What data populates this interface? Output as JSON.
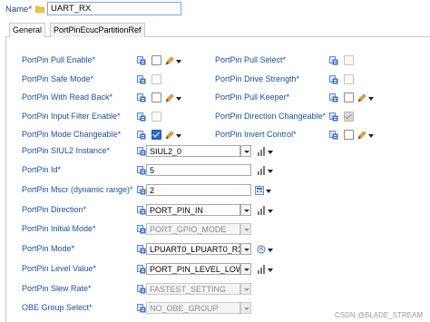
{
  "name": {
    "label": "Name",
    "required_mark": "*",
    "value": "UART_RX"
  },
  "tabs": [
    {
      "label": "General",
      "active": true
    },
    {
      "label": "PortPinEcucPartitionRef",
      "active": false
    }
  ],
  "left_checkbox_rows": [
    {
      "label": "PortPin Pull Enable*",
      "checked": false,
      "disabled": false,
      "has_pencil": true
    },
    {
      "label": "PortPin Safe Mode*",
      "checked": false,
      "disabled": true,
      "has_pencil": false
    },
    {
      "label": "PortPin With Read Back*",
      "checked": false,
      "disabled": false,
      "has_pencil": true
    },
    {
      "label": "PortPin Input Filter Enable*",
      "checked": false,
      "disabled": true,
      "has_pencil": false
    },
    {
      "label": "PortPin Mode Changeable*",
      "checked": true,
      "disabled": false,
      "has_pencil": true
    }
  ],
  "right_checkbox_rows": [
    {
      "label": "PortPin Pull Select*",
      "checked": false,
      "disabled": true,
      "has_pencil": false
    },
    {
      "label": "PortPin Drive Strength*",
      "checked": false,
      "disabled": true,
      "has_pencil": false
    },
    {
      "label": "PortPin Pull Keeper*",
      "checked": false,
      "disabled": false,
      "has_pencil": true
    },
    {
      "label": "PortPin Direction Changeable*",
      "checked": true,
      "disabled": true,
      "has_pencil": false
    },
    {
      "label": "PortPin Invert Control*",
      "checked": false,
      "disabled": false,
      "has_pencil": true
    }
  ],
  "field_rows": [
    {
      "label": "PortPin SIUL2 Instance*",
      "value": "SIUL2_0",
      "kind": "combo",
      "disabled": false,
      "trail": "chart"
    },
    {
      "label": "PortPin Id*",
      "value": "5",
      "kind": "text",
      "disabled": false,
      "trail": "chart"
    },
    {
      "label": "PortPin Mscr (dynamic range)*",
      "value": "2",
      "kind": "text-wide",
      "disabled": false,
      "trail": "calc"
    },
    {
      "label": "PortPin Direction*",
      "value": "PORT_PIN_IN",
      "kind": "combo",
      "disabled": false,
      "trail": "chart"
    },
    {
      "label": "PortPin Initial Mode*",
      "value": "PORT_GPIO_MODE",
      "kind": "combo",
      "disabled": true,
      "trail": "none"
    },
    {
      "label": "PortPin Mode*",
      "value": "LPUART0_LPUART0_RX",
      "kind": "combo",
      "disabled": false,
      "trail": "fx"
    },
    {
      "label": "PortPin Level Value*",
      "value": "PORT_PIN_LEVEL_LOW",
      "kind": "combo",
      "disabled": false,
      "trail": "chart"
    },
    {
      "label": "PortPin Slew Rate*",
      "value": "FASTEST_SETTING",
      "kind": "combo",
      "disabled": true,
      "trail": "none"
    },
    {
      "label": "OBE Group Select*",
      "value": "NO_OBE_GROUP",
      "kind": "combo",
      "disabled": true,
      "trail": "none"
    }
  ],
  "watermark": "CSDN @BLADE_STREAM",
  "colors": {
    "label_blue": "#1a4f9c",
    "check_blue": "#2a6ad0",
    "config_icon_blue": "#3b6fc4",
    "pencil_orange": "#e07b00"
  }
}
